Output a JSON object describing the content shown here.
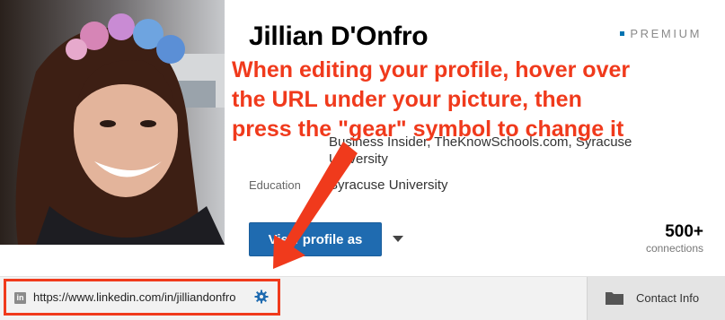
{
  "profile": {
    "name": "Jillian D'Onfro",
    "badge": "PREMIUM",
    "past_partial": "Business Insider, TheKnowSchools.com, Syracuse",
    "past_tail": "University",
    "education_label": "Education",
    "education_value": "Syracuse University",
    "view_profile_label": "View profile as",
    "connections_count": "500+",
    "connections_label": "connections"
  },
  "annotation": {
    "text": "When editing your profile, hover over\nthe URL under your picture, then\npress the \"gear\" symbol to change it"
  },
  "url_bar": {
    "brand_icon": "in",
    "url": "https://www.linkedin.com/in/jilliandonfro",
    "gear_icon": "gear-icon"
  },
  "contact": {
    "label": "Contact Info",
    "icon": "folder-icon"
  },
  "colors": {
    "annotation": "#f03a1c",
    "primary": "#1f6bb0",
    "premium_mark": "#0073b1"
  }
}
